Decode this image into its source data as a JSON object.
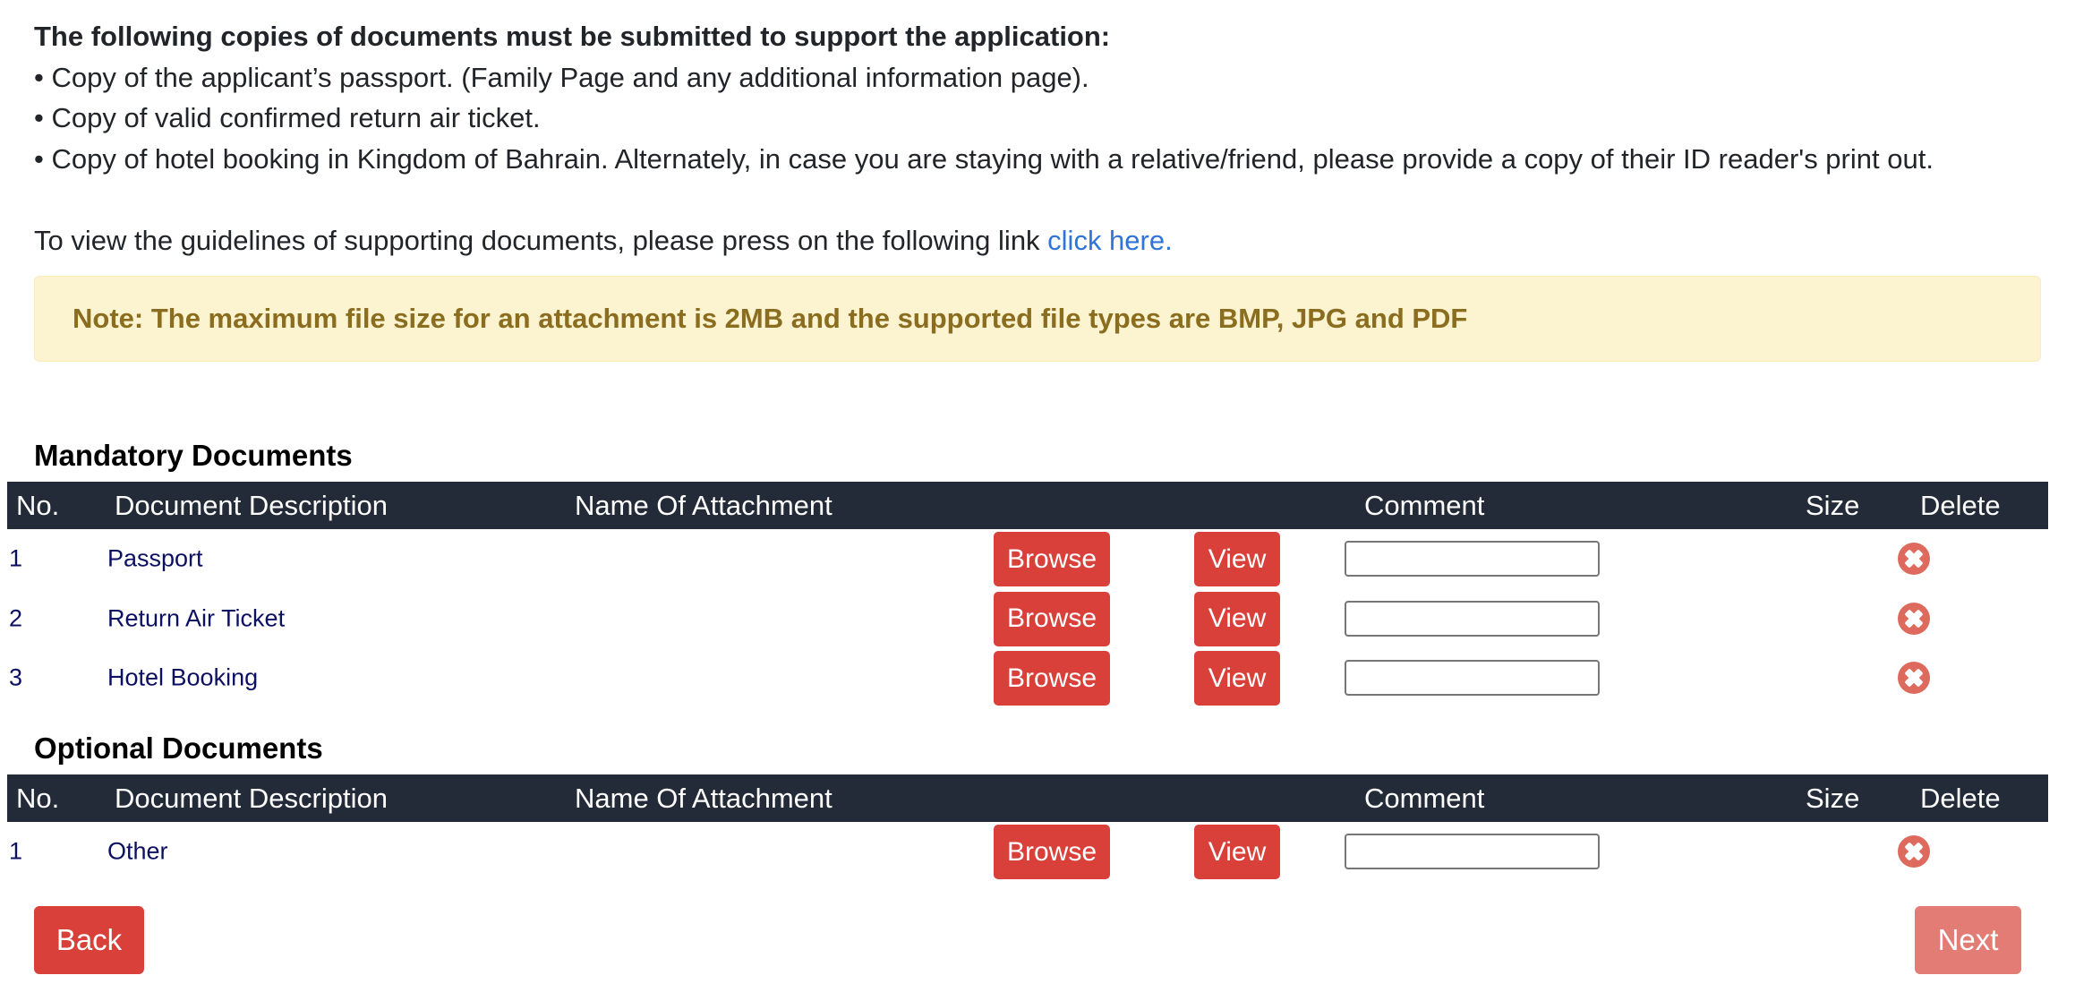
{
  "intro": {
    "title": "The following copies of documents must be submitted to support the application:",
    "bullets": [
      "• Copy of the applicant’s passport. (Family Page and any additional information page).",
      "• Copy of valid confirmed return air ticket.",
      "• Copy of hotel booking in Kingdom of Bahrain. Alternately, in case you are staying with a relative/friend, please provide a copy of their ID reader's print out."
    ],
    "guideline_text": "To view the guidelines of supporting documents, please press on the following link ",
    "guideline_link": "click here."
  },
  "note": "Note: The maximum file size for an attachment is 2MB and the supported file types are BMP, JPG and PDF",
  "columns": {
    "no": "No.",
    "description": "Document Description",
    "attachment": "Name Of Attachment",
    "comment": "Comment",
    "size": "Size",
    "delete": "Delete"
  },
  "buttons": {
    "browse": "Browse",
    "view": "View",
    "back": "Back",
    "next": "Next"
  },
  "mandatory": {
    "title": "Mandatory Documents",
    "rows": [
      {
        "no": "1",
        "description": "Passport",
        "attachment": "",
        "comment": "",
        "size": ""
      },
      {
        "no": "2",
        "description": "Return Air Ticket",
        "attachment": "",
        "comment": "",
        "size": ""
      },
      {
        "no": "3",
        "description": "Hotel Booking",
        "attachment": "",
        "comment": "",
        "size": ""
      }
    ]
  },
  "optional": {
    "title": "Optional Documents",
    "rows": [
      {
        "no": "1",
        "description": "Other",
        "attachment": "",
        "comment": "",
        "size": ""
      }
    ]
  },
  "icons": {
    "delete": "delete-circle-x-icon"
  },
  "colors": {
    "accent": "#d9403a",
    "header_bg": "#232a38",
    "note_bg": "#fcf3d0",
    "note_text": "#8a6d1f",
    "link": "#2f74d9",
    "next_disabled": "#e47c76"
  }
}
